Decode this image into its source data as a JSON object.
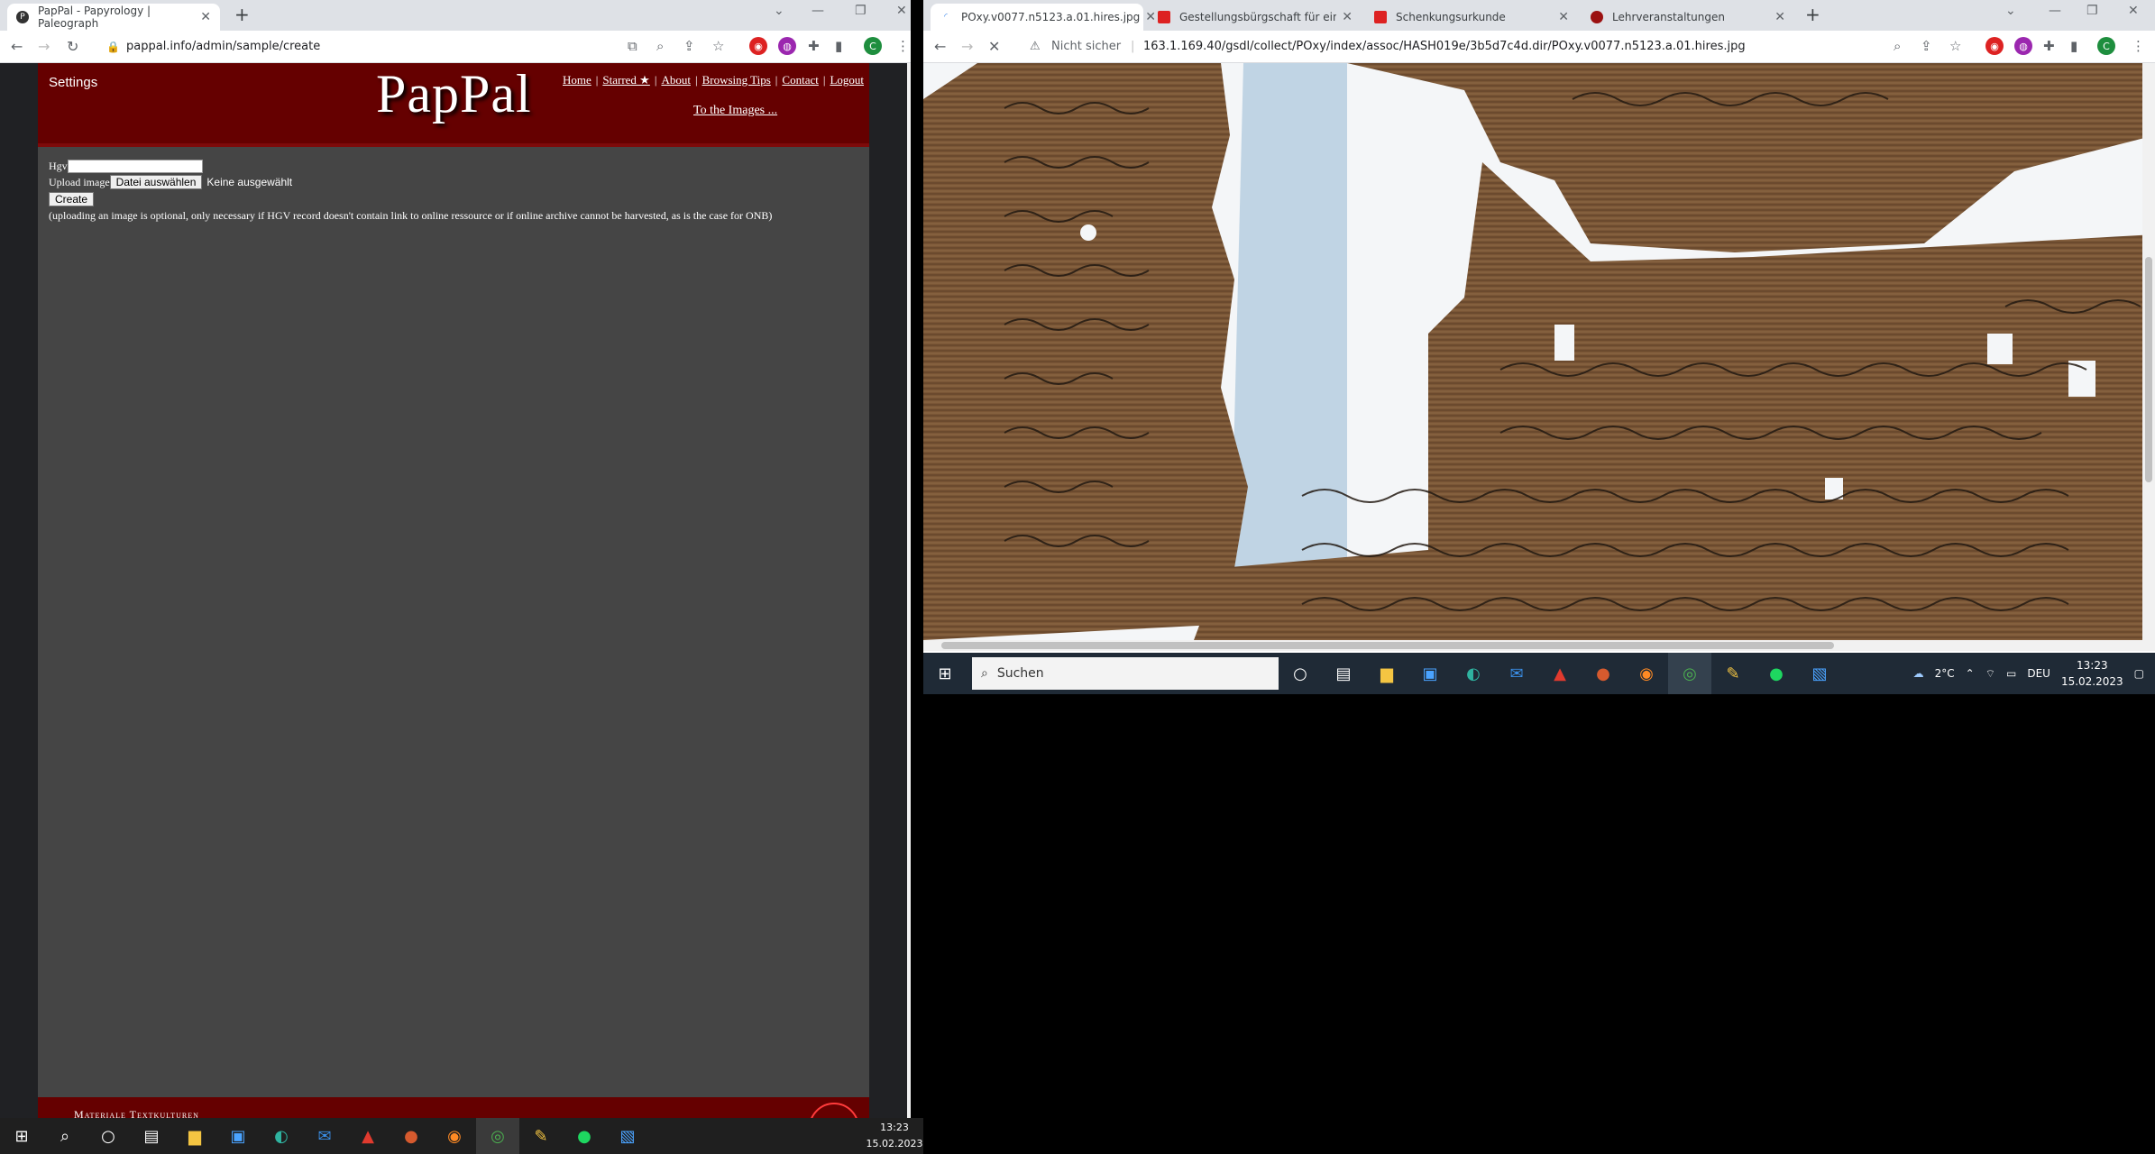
{
  "left_browser": {
    "tab": {
      "title": "PapPal - Papyrology | Paleograph",
      "close": "✕"
    },
    "new_tab": "+",
    "window_controls": [
      "⌄",
      "—",
      "❐",
      "✕"
    ],
    "url": "pappal.info/admin/sample/create",
    "profile_initial": "C"
  },
  "pappal": {
    "settings": "Settings",
    "logo": "PapPal",
    "nav": {
      "home": "Home",
      "starred": "Starred ★",
      "about": "About",
      "browsing_tips": "Browsing Tips",
      "contact": "Contact",
      "logout": "Logout",
      "separator": "|"
    },
    "to_images": "To the Images ...",
    "form": {
      "hgv_label": "Hgv",
      "hgv_value": "",
      "upload_label": "Upload image",
      "file_button": "Datei auswählen",
      "no_file": "Keine ausgewählt",
      "create_button": "Create",
      "note": "(uploading an image is optional, only necessary if HGV record doesn't contain link to online ressource or if online archive cannot be harvested, as is the case for ONB)"
    },
    "footer": "Materiale Textkulturen"
  },
  "left_taskbar": {
    "clock_time": "13:23",
    "clock_date": "15.02.2023"
  },
  "right_browser": {
    "tabs": [
      {
        "title": "POxy.v0077.n5123.a.01.hires.jpg",
        "active": true
      },
      {
        "title": "Gestellungsbürgschaft für eine N",
        "active": false
      },
      {
        "title": "Schenkungsurkunde",
        "active": false
      },
      {
        "title": "Lehrveranstaltungen",
        "active": false
      }
    ],
    "close": "✕",
    "new_tab": "+",
    "security": "Nicht sicher",
    "url": "163.1.169.40/gsdl/collect/POxy/index/assoc/HASH019e/3b5d7c4d.dir/POxy.v0077.n5123.a.01.hires.jpg",
    "profile_initial": "C"
  },
  "right_taskbar": {
    "search_placeholder": "Suchen",
    "weather": "2°C",
    "language": "DEU",
    "clock_time": "13:23",
    "clock_date": "15.02.2023"
  },
  "colors": {
    "pappal_red": "#650000",
    "pappal_body": "#454545",
    "papyrus": "#7a5a3a"
  }
}
